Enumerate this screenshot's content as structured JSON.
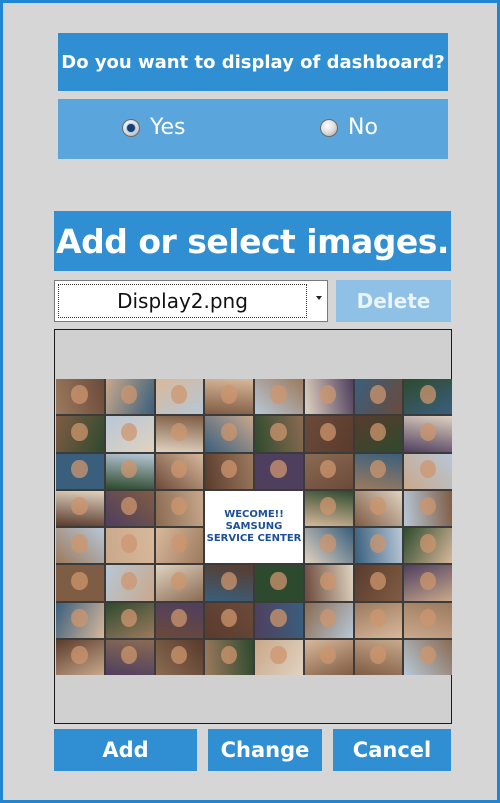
{
  "prompt": "Do you want to display of dashboard?",
  "display_option": {
    "yes_label": "Yes",
    "no_label": "No",
    "selected": "Yes"
  },
  "images_heading": "Add or select images.",
  "image_select": {
    "selected_value": "Display2.png"
  },
  "delete_label": "Delete",
  "preview": {
    "card_lines": [
      "WECOME!!",
      "SAMSUNG",
      "SERVICE CENTER"
    ]
  },
  "actions": {
    "add_label": "Add",
    "change_label": "Change",
    "cancel_label": "Cancel"
  },
  "colors": {
    "accent_blue": "#2f8fd2",
    "radio_panel_blue": "#5aa5dc",
    "disabled_blue": "#8fc0e6",
    "background_gray": "#d6d6d6"
  }
}
